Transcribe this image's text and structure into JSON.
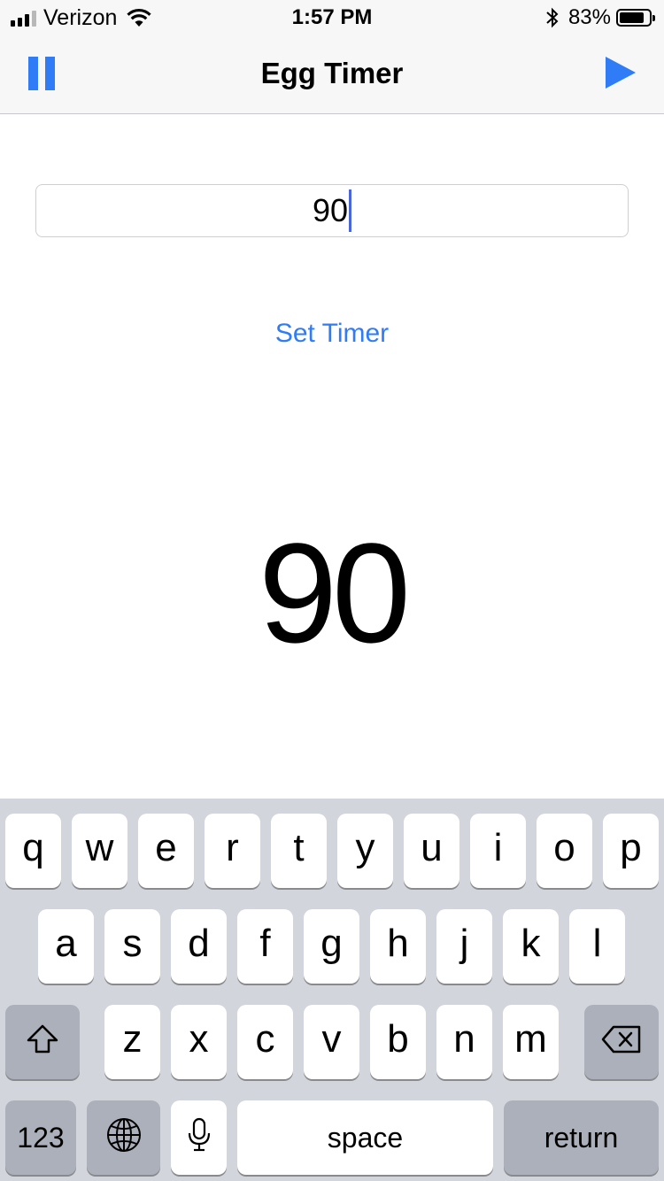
{
  "status_bar": {
    "carrier": "Verizon",
    "time": "1:57 PM",
    "battery_percent": "83%",
    "battery_level": 0.83,
    "icons": [
      "signal-icon",
      "wifi-icon",
      "bluetooth-icon",
      "battery-icon"
    ]
  },
  "nav": {
    "title": "Egg Timer",
    "left_icon": "pause-icon",
    "right_icon": "play-icon"
  },
  "input": {
    "value": "90"
  },
  "set_timer_label": "Set Timer",
  "timer_display": "90",
  "keyboard": {
    "row1": [
      "q",
      "w",
      "e",
      "r",
      "t",
      "y",
      "u",
      "i",
      "o",
      "p"
    ],
    "row2": [
      "a",
      "s",
      "d",
      "f",
      "g",
      "h",
      "j",
      "k",
      "l"
    ],
    "row3": [
      "z",
      "x",
      "c",
      "v",
      "b",
      "n",
      "m"
    ],
    "numbers_label": "123",
    "space_label": "space",
    "return_label": "return",
    "icons": [
      "shift-icon",
      "delete-icon",
      "globe-icon",
      "microphone-icon"
    ]
  },
  "colors": {
    "accent": "#2f7cf6",
    "caret": "#4a66d9",
    "keyboard_background": "#d2d5db",
    "dark_key": "#abb0ba"
  }
}
